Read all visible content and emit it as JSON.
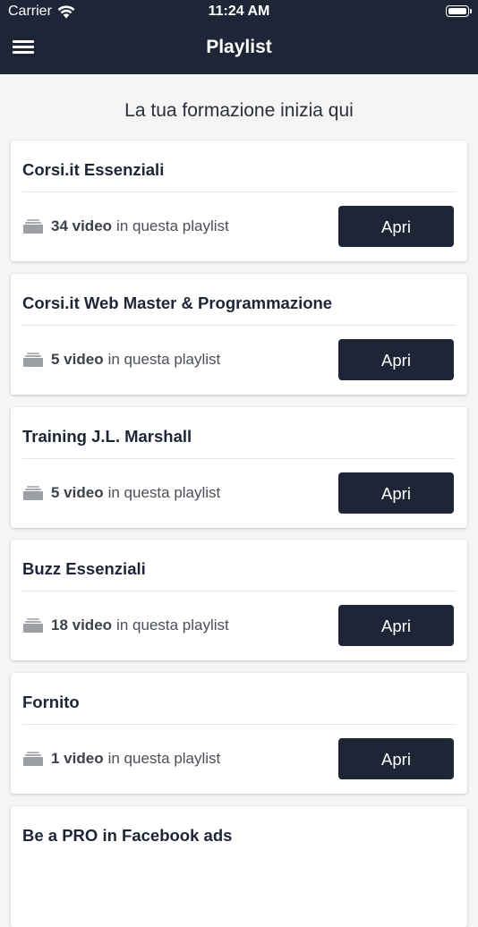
{
  "status_bar": {
    "carrier": "Carrier",
    "time": "11:24 AM",
    "wifi_icon": "wifi-icon",
    "battery_icon": "battery-icon"
  },
  "nav": {
    "title": "Playlist",
    "menu_icon": "hamburger-menu-icon"
  },
  "subtitle": "La tua formazione inizia qui",
  "colors": {
    "header_bg": "#1e2536",
    "button_bg": "#1e2536",
    "page_bg": "#f5f5f6",
    "icon_gray": "#9b9ea3"
  },
  "playlists": [
    {
      "title": "Corsi.it Essenziali",
      "count": "34 video",
      "suffix": "in questa playlist",
      "button": "Apri"
    },
    {
      "title": "Corsi.it Web Master & Programmazione",
      "count": "5 video",
      "suffix": "in questa playlist",
      "button": "Apri"
    },
    {
      "title": "Training J.L. Marshall",
      "count": "5 video",
      "suffix": "in questa playlist",
      "button": "Apri"
    },
    {
      "title": "Buzz Essenziali",
      "count": "18 video",
      "suffix": "in questa playlist",
      "button": "Apri"
    },
    {
      "title": "Fornito",
      "count": "1 video",
      "suffix": "in questa playlist",
      "button": "Apri"
    },
    {
      "title": "Be a PRO in Facebook ads",
      "count": "",
      "suffix": "",
      "button": ""
    }
  ]
}
